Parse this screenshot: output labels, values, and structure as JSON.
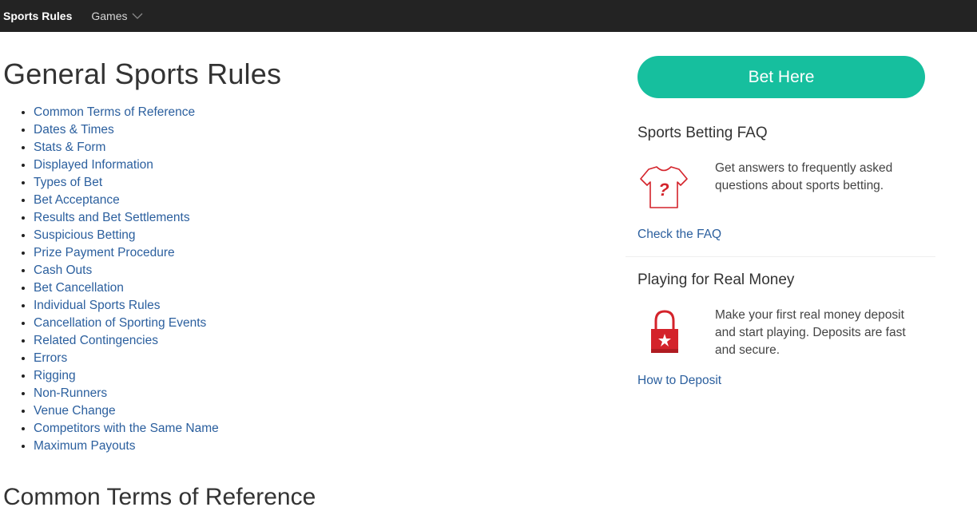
{
  "nav": {
    "brand": "Sports Rules",
    "games": "Games"
  },
  "page_title": "General Sports Rules",
  "toc": [
    "Common Terms of Reference",
    "Dates & Times",
    "Stats & Form",
    "Displayed Information",
    "Types of Bet",
    "Bet Acceptance",
    "Results and Bet Settlements",
    "Suspicious Betting",
    "Prize Payment Procedure",
    "Cash Outs",
    "Bet Cancellation",
    "Individual Sports Rules",
    "Cancellation of Sporting Events",
    "Related Contingencies",
    "Errors",
    "Rigging",
    "Non-Runners",
    "Venue Change",
    "Competitors with the Same Name",
    "Maximum Payouts"
  ],
  "next_heading": "Common Terms of Reference",
  "sidebar": {
    "bet_button": "Bet Here",
    "faq": {
      "title": "Sports Betting FAQ",
      "text": "Get answers to frequently asked questions about sports betting.",
      "link": "Check the FAQ",
      "icon": "shirt-question-icon"
    },
    "money": {
      "title": "Playing for Real Money",
      "text": "Make your first real money deposit and start playing. Deposits are fast and secure.",
      "link": "How to Deposit",
      "icon": "padlock-star-icon"
    }
  },
  "colors": {
    "topbar": "#232323",
    "accent_button": "#16bf9e",
    "link": "#2b5f9e",
    "icon_red": "#d4232b"
  }
}
